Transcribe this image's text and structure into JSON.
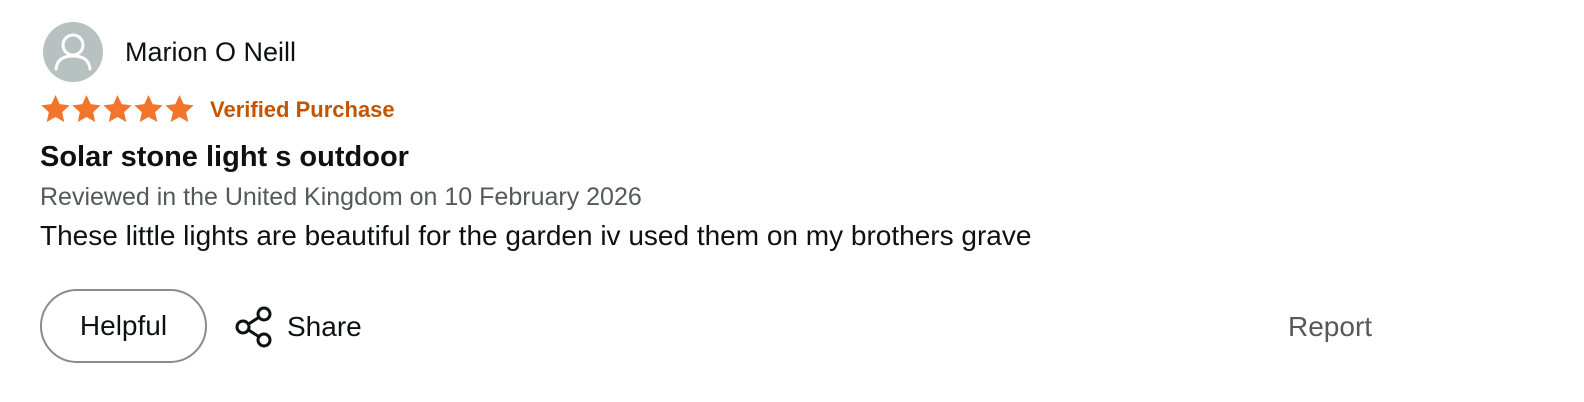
{
  "review": {
    "reviewer_name": "Marion O Neill",
    "rating": 5,
    "rating_max": 5,
    "verified_label": "Verified Purchase",
    "title": "Solar stone light s outdoor",
    "meta": "Reviewed in the United Kingdom on 10 February 2026",
    "body": "These little lights are beautiful for the garden iv used them on my brothers grave"
  },
  "actions": {
    "helpful_label": "Helpful",
    "share_label": "Share",
    "report_label": "Report"
  },
  "icons": {
    "avatar": "person-avatar-icon",
    "star": "star-icon",
    "share": "share-icon"
  },
  "colors": {
    "star": "#f3742b",
    "verified": "#c45500",
    "avatar_bg": "#b7c1c0",
    "meta_text": "#565959",
    "report_text": "#565959"
  }
}
